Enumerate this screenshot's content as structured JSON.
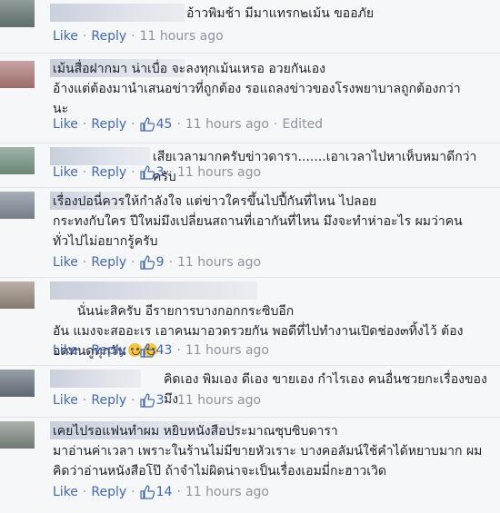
{
  "actions": {
    "like": "Like",
    "reply": "Reply",
    "separator": "·",
    "edited": "Edited"
  },
  "comments": [
    {
      "text": "อ้าวพิมช้า มีมาแทรก๒เม้น ขออภัย",
      "likes": "",
      "time": "11 hours ago",
      "edited": false
    },
    {
      "text": "เม้นสื่อฝากมา น่าเบื่อ จะลงทุกเม้นเหรอ อวยกันเอง\nอ้างแต่ต้องมานำเสนอข่าวที่ถูกต้อง รอแถลงข่าวของโรงพยาบาลถูกต้องกว่า\nนะ",
      "likes": "45",
      "time": "11 hours ago",
      "edited": true
    },
    {
      "text": "เสียเวลามากครับข่าวดารา.......เอาเวลาไปหาเห็บหมาดีกว่าครับ",
      "likes": "3",
      "time": "11 hours ago",
      "edited": false
    },
    {
      "text": "เรื่องปอนี่ควรให้กำลังใจ แต่ข่าวใครขึ้นไปปี้กันที่ไหน ไปลอย\nกระทงกับใคร ปีใหม่มึงเปลี่ยนสถานที่เอากันที่ไหน มึงจะทำห่าอะไร ผมว่าคน\nทั่วไปไม่อยากรู้ครับ",
      "likes": "9",
      "time": "11 hours ago",
      "edited": false
    },
    {
      "text": "นั่นน่ะสิครับ อีรายการบางกอกกระซิบอีก\nอัน แมงจะสออะเร เอาคนมาอวดรวยกัน พอดีที่ไปทำงานเปิดช่อง๓ทิ้งไว้ ต้อง\nอดทนดูทุกวัน",
      "likes": "43",
      "time": "11 hours ago",
      "edited": false
    },
    {
      "text": "คิดเอง พิมเอง ดีเอง ขายเอง กำไรเอง คนอื่นชวยกะเรื่องของมึง",
      "likes": "3",
      "time": "11 hours ago",
      "edited": false
    },
    {
      "text": "เคยไปรอแฟนทำผม หยิบหนังสือประมาณซุบซิบดารา\nมาอ่านค่าเวลา เพราะในร้านไม่มีขายหัวเราะ บางคอลัมน์ใช้คำได้หยาบมาก ผม\nคิดว่าอ่านหนังสือโป๊ ถ้าจำไม่ผิดน่าจะเป็นเรื่องเอมมี่กะฮาวเวิด",
      "likes": "14",
      "time": "11 hours ago",
      "edited": false
    }
  ],
  "icons": {
    "like": "thumbs-up-icon",
    "emoji": "laughing-crying-emoji-icon"
  },
  "colors": {
    "link": "#4267b2",
    "meta": "#8d949e",
    "text": "#1d2129",
    "background": "#f6f7f9"
  }
}
